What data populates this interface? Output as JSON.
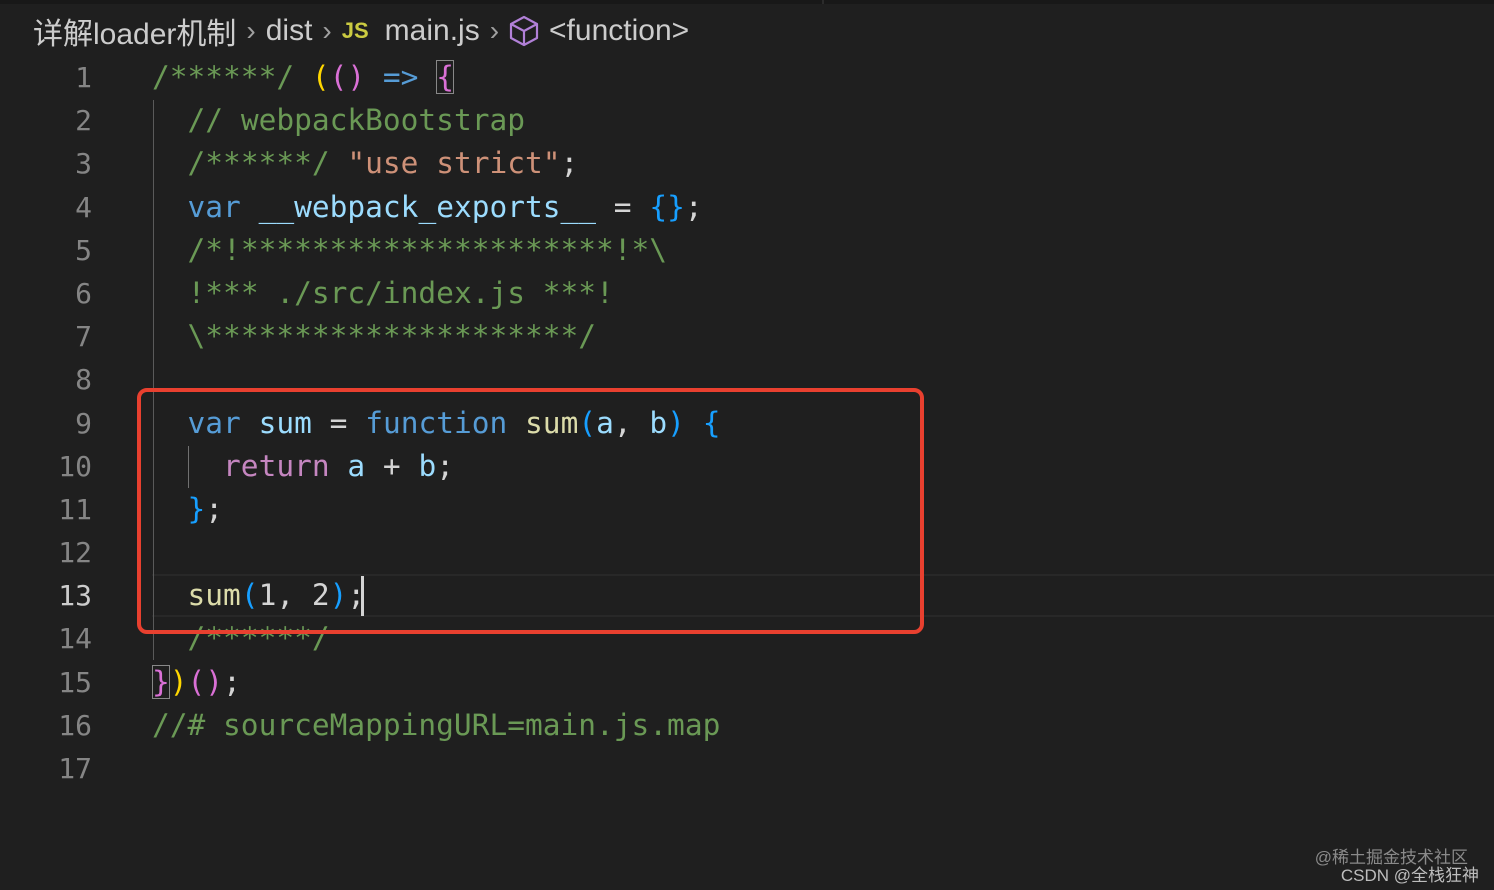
{
  "breadcrumb": {
    "folder": "详解loader机制",
    "subfolder": "dist",
    "file_icon": "JS",
    "file": "main.js",
    "symbol_icon": "cube-icon",
    "symbol": "<function>"
  },
  "editor": {
    "current_line": 13,
    "line_numbers": [
      "1",
      "2",
      "3",
      "4",
      "5",
      "6",
      "7",
      "8",
      "9",
      "10",
      "11",
      "12",
      "13",
      "14",
      "15",
      "16",
      "17"
    ],
    "lines": [
      [
        [
          "com",
          "/******/ "
        ],
        [
          "b1",
          "("
        ],
        [
          "b2",
          "()"
        ],
        [
          "txt",
          " "
        ],
        [
          "kw",
          "=>"
        ],
        [
          "txt",
          " "
        ],
        [
          "b2",
          "{"
        ]
      ],
      [
        [
          "txt",
          "  "
        ],
        [
          "com",
          "// webpackBootstrap"
        ]
      ],
      [
        [
          "txt",
          "  "
        ],
        [
          "com",
          "/******/ "
        ],
        [
          "str",
          "\"use strict\""
        ],
        [
          "txt",
          ";"
        ]
      ],
      [
        [
          "txt",
          "  "
        ],
        [
          "kw",
          "var"
        ],
        [
          "txt",
          " "
        ],
        [
          "var",
          "__webpack_exports__"
        ],
        [
          "txt",
          " = "
        ],
        [
          "b3",
          "{}"
        ],
        [
          "txt",
          ";"
        ]
      ],
      [
        [
          "txt",
          "  "
        ],
        [
          "com",
          "/*!*********************!*\\"
        ]
      ],
      [
        [
          "txt",
          "  "
        ],
        [
          "com",
          "!*** ./src/index.js ***!"
        ]
      ],
      [
        [
          "txt",
          "  "
        ],
        [
          "com",
          "\\*********************/"
        ]
      ],
      [],
      [
        [
          "txt",
          "  "
        ],
        [
          "kw",
          "var"
        ],
        [
          "txt",
          " "
        ],
        [
          "var",
          "sum"
        ],
        [
          "txt",
          " = "
        ],
        [
          "kw",
          "function"
        ],
        [
          "txt",
          " "
        ],
        [
          "fn",
          "sum"
        ],
        [
          "b3",
          "("
        ],
        [
          "var",
          "a"
        ],
        [
          "txt",
          ", "
        ],
        [
          "var",
          "b"
        ],
        [
          "b3",
          ")"
        ],
        [
          "txt",
          " "
        ],
        [
          "b3",
          "{"
        ]
      ],
      [
        [
          "txt",
          "    "
        ],
        [
          "ctl",
          "return"
        ],
        [
          "txt",
          " "
        ],
        [
          "var",
          "a"
        ],
        [
          "txt",
          " + "
        ],
        [
          "var",
          "b"
        ],
        [
          "txt",
          ";"
        ]
      ],
      [
        [
          "txt",
          "  "
        ],
        [
          "b3",
          "}"
        ],
        [
          "txt",
          ";"
        ]
      ],
      [],
      [
        [
          "txt",
          "  "
        ],
        [
          "fn",
          "sum"
        ],
        [
          "b3",
          "("
        ],
        [
          "txt",
          "1, 2"
        ],
        [
          "b3",
          ")"
        ],
        [
          "txt",
          ";"
        ]
      ],
      [
        [
          "txt",
          "  "
        ],
        [
          "com",
          "/******/"
        ]
      ],
      [
        [
          "b2",
          "}"
        ],
        [
          "b1",
          ")"
        ],
        [
          "b2",
          "()"
        ],
        [
          "txt",
          ";"
        ]
      ],
      [
        [
          "com",
          "//# sourceMappingURL=main.js.map"
        ]
      ],
      []
    ]
  },
  "watermark": {
    "line1": "@稀土掘金技术社区",
    "line2": "CSDN @全栈狂神"
  },
  "colors": {
    "highlight_box": "#e8402f",
    "comment": "#6a9955",
    "keyword": "#569cd6",
    "string": "#ce9178"
  }
}
